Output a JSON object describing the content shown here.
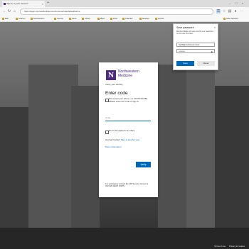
{
  "browser": {
    "tab_title": "Sign in to your account",
    "url": "https://login.microsoftonline.com/common/oauth2/authorize",
    "favorites": [
      {
        "label": "Mail"
      },
      {
        "label": "Amazon"
      },
      {
        "label": "Northwestern"
      },
      {
        "label": "Canvas"
      },
      {
        "label": "News"
      },
      {
        "label": "Library"
      },
      {
        "label": "Maps"
      },
      {
        "label": "Drive"
      },
      {
        "label": "Calendar"
      },
      {
        "label": "Weather"
      },
      {
        "label": "Fitness"
      }
    ],
    "other_favorites": "Other favorites"
  },
  "card": {
    "logo_letter": "N",
    "brand_line1": "Northwestern",
    "brand_line2": "Medicine",
    "user": "Verify your identity",
    "heading": "Enter code",
    "sms_text": "We texted your phone +X XXXXXXXX50. Please enter the code to sign in.",
    "code_placeholder": "Code",
    "remember_label": "Don't ask again for 14 days",
    "trouble_text": "Having trouble?",
    "trouble_link": "Sign in another way",
    "more_info": "More information",
    "verify_label": "Verify",
    "footer": "For assistance contact the NM Service Center at 312.926.HELP (4357)."
  },
  "popup": {
    "title": "Save password",
    "description": "Microsoft Edge will save and fill your password for this site next time.",
    "username": "NetID@northwestern.edu",
    "password_mask": "••••••••••",
    "save_label": "Save",
    "never_label": "Never"
  },
  "page_footer": {
    "terms": "Terms of use",
    "privacy": "Privacy & cookies"
  }
}
